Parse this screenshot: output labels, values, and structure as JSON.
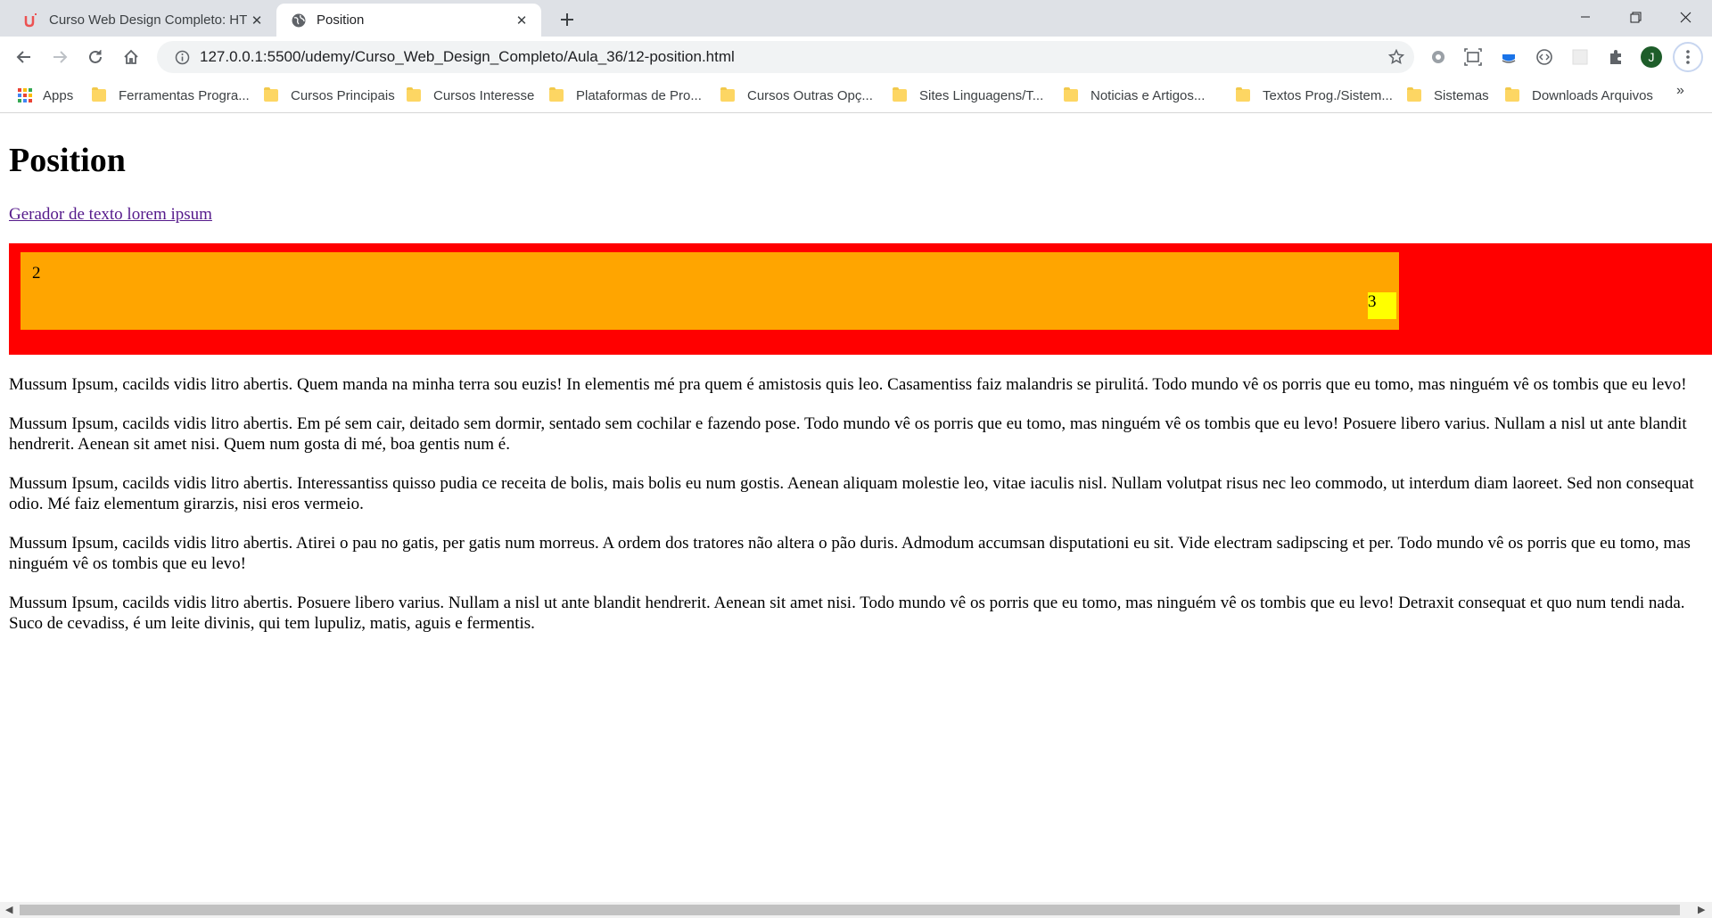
{
  "tabs": [
    {
      "title": "Curso Web Design Completo: HT",
      "active": false
    },
    {
      "title": "Position",
      "active": true
    }
  ],
  "address_bar": {
    "url": "127.0.0.1:5500/udemy/Curso_Web_Design_Completo/Aula_36/12-position.html"
  },
  "profile": {
    "initial": "J"
  },
  "bookmarks": [
    {
      "label": "Apps",
      "type": "apps"
    },
    {
      "label": "Ferramentas Progra...",
      "type": "folder"
    },
    {
      "label": "Cursos Principais",
      "type": "folder"
    },
    {
      "label": "Cursos Interesse",
      "type": "folder"
    },
    {
      "label": "Plataformas de Pro...",
      "type": "folder"
    },
    {
      "label": "Cursos Outras Opç...",
      "type": "folder"
    },
    {
      "label": "Sites Linguagens/T...",
      "type": "folder"
    },
    {
      "label": "Noticias e Artigos...",
      "type": "folder"
    },
    {
      "label": "Textos Prog./Sistem...",
      "type": "folder"
    },
    {
      "label": "Sistemas",
      "type": "folder"
    },
    {
      "label": "Downloads Arquivos",
      "type": "folder"
    }
  ],
  "bookmarks_overflow": "»",
  "page": {
    "heading": "Position",
    "link": "Gerador de texto lorem ipsum",
    "box2_label": "2",
    "box3_label": "3",
    "colors": {
      "outer": "#ff0000",
      "middle": "#ffa500",
      "inner": "#ffff00"
    },
    "paragraphs": [
      "Mussum Ipsum, cacilds vidis litro abertis. Quem manda na minha terra sou euzis! In elementis mé pra quem é amistosis quis leo. Casamentiss faiz malandris se pirulitá. Todo mundo vê os porris que eu tomo, mas ninguém vê os tombis que eu levo!",
      "Mussum Ipsum, cacilds vidis litro abertis. Em pé sem cair, deitado sem dormir, sentado sem cochilar e fazendo pose. Todo mundo vê os porris que eu tomo, mas ninguém vê os tombis que eu levo! Posuere libero varius. Nullam a nisl ut ante blandit hendrerit. Aenean sit amet nisi. Quem num gosta di mé, boa gentis num é.",
      "Mussum Ipsum, cacilds vidis litro abertis. Interessantiss quisso pudia ce receita de bolis, mais bolis eu num gostis. Aenean aliquam molestie leo, vitae iaculis nisl. Nullam volutpat risus nec leo commodo, ut interdum diam laoreet. Sed non consequat odio. Mé faiz elementum girarzis, nisi eros vermeio.",
      "Mussum Ipsum, cacilds vidis litro abertis. Atirei o pau no gatis, per gatis num morreus. A ordem dos tratores não altera o pão duris. Admodum accumsan disputationi eu sit. Vide electram sadipscing et per. Todo mundo vê os porris que eu tomo, mas ninguém vê os tombis que eu levo!",
      "Mussum Ipsum, cacilds vidis litro abertis. Posuere libero varius. Nullam a nisl ut ante blandit hendrerit. Aenean sit amet nisi. Todo mundo vê os porris que eu tomo, mas ninguém vê os tombis que eu levo! Detraxit consequat et quo num tendi nada. Suco de cevadiss, é um leite divinis, qui tem lupuliz, matis, aguis e fermentis."
    ]
  }
}
